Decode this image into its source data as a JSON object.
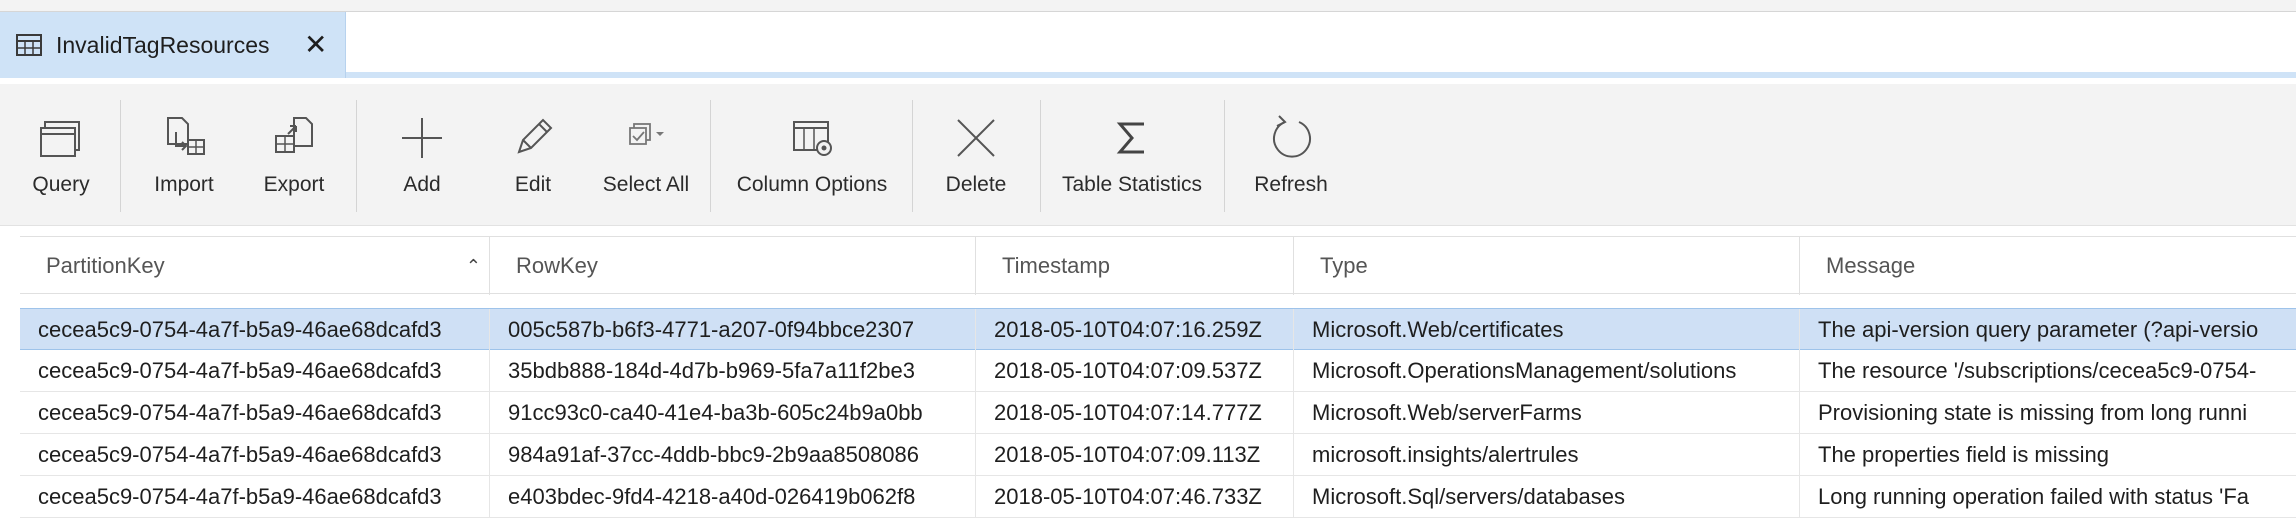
{
  "tab": {
    "title": "InvalidTagResources",
    "close": "✕",
    "icon": "table-icon"
  },
  "toolbar": {
    "query": "Query",
    "import": "Import",
    "export": "Export",
    "add": "Add",
    "edit": "Edit",
    "select_all": "Select All",
    "column_options": "Column Options",
    "delete": "Delete",
    "table_statistics": "Table Statistics",
    "refresh": "Refresh"
  },
  "table": {
    "headers": [
      "PartitionKey",
      "RowKey",
      "Timestamp",
      "Type",
      "Message"
    ],
    "sort": {
      "column": "PartitionKey",
      "direction": "ascending"
    },
    "rows": [
      [
        "cecea5c9-0754-4a7f-b5a9-46ae68dcafd3",
        "005c587b-b6f3-4771-a207-0f94bbce2307",
        "2018-05-10T04:07:16.259Z",
        "Microsoft.Web/certificates",
        "The api-version query parameter (?api-versio"
      ],
      [
        "cecea5c9-0754-4a7f-b5a9-46ae68dcafd3",
        "35bdb888-184d-4d7b-b969-5fa7a11f2be3",
        "2018-05-10T04:07:09.537Z",
        "Microsoft.OperationsManagement/solutions",
        "The resource '/subscriptions/cecea5c9-0754-"
      ],
      [
        "cecea5c9-0754-4a7f-b5a9-46ae68dcafd3",
        "91cc93c0-ca40-41e4-ba3b-605c24b9a0bb",
        "2018-05-10T04:07:14.777Z",
        "Microsoft.Web/serverFarms",
        "Provisioning state is missing from long runni"
      ],
      [
        "cecea5c9-0754-4a7f-b5a9-46ae68dcafd3",
        "984a91af-37cc-4ddb-bbc9-2b9aa8508086",
        "2018-05-10T04:07:09.113Z",
        "microsoft.insights/alertrules",
        "The properties field is missing"
      ],
      [
        "cecea5c9-0754-4a7f-b5a9-46ae68dcafd3",
        "e403bdec-9fd4-4218-a40d-026419b062f8",
        "2018-05-10T04:07:46.733Z",
        "Microsoft.Sql/servers/databases",
        "Long running operation failed with status 'Fa"
      ]
    ],
    "selected_row": 0
  },
  "colors": {
    "tab_bg": "#cfe3f7",
    "selected_row": "#cfe0f5",
    "toolbar_bg": "#f3f3f3"
  }
}
